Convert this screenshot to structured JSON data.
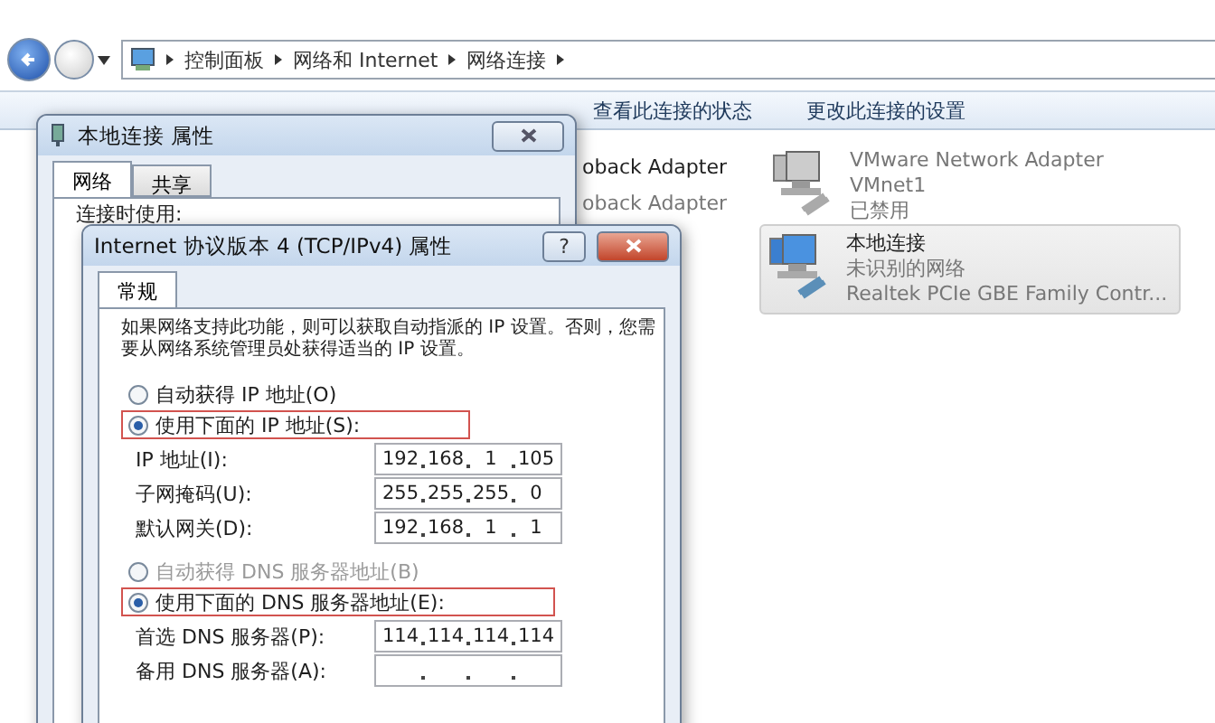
{
  "explorer": {
    "breadcrumb": [
      "控制面板",
      "网络和 Internet",
      "网络连接"
    ],
    "toolbar": [
      "查看此连接的状态",
      "更改此连接的设置"
    ],
    "adapters": [
      {
        "kind": "partial",
        "lines": [
          "oback Adapter"
        ],
        "disabled": false,
        "selected": false
      },
      {
        "kind": "partial",
        "lines": [
          "oback Adapter"
        ],
        "disabled": true,
        "selected": false
      },
      {
        "kind": "full",
        "lines": [
          "VMware Network Adapter",
          "VMnet1",
          "已禁用"
        ],
        "disabled": true,
        "selected": false
      },
      {
        "kind": "full",
        "lines": [
          "本地连接",
          "未识别的网络",
          "Realtek PCIe GBE Family Contr..."
        ],
        "disabled": false,
        "selected": true
      }
    ]
  },
  "properties_dialog": {
    "title": "本地连接 属性",
    "tabs": [
      {
        "label": "网络",
        "selected": true
      },
      {
        "label": "共享",
        "selected": false
      }
    ],
    "connect_using_label": "连接时使用:"
  },
  "ipv4_dialog": {
    "title": "Internet 协议版本 4 (TCP/IPv4) 属性",
    "help": "?",
    "tabs": [
      {
        "label": "常规",
        "selected": true
      }
    ],
    "description": "如果网络支持此功能，则可以获取自动指派的 IP 设置。否则，您需要从网络系统管理员处获得适当的 IP 设置。",
    "ip_mode": [
      {
        "label": "自动获得 IP 地址(O)",
        "selected": false,
        "disabled": false,
        "highlighted": false
      },
      {
        "label": "使用下面的 IP 地址(S):",
        "selected": true,
        "disabled": false,
        "highlighted": true
      }
    ],
    "ip_fields": [
      {
        "label": "IP 地址(I):",
        "octets": [
          "192",
          "168",
          "1",
          "105"
        ]
      },
      {
        "label": "子网掩码(U):",
        "octets": [
          "255",
          "255",
          "255",
          "0"
        ]
      },
      {
        "label": "默认网关(D):",
        "octets": [
          "192",
          "168",
          "1",
          "1"
        ]
      }
    ],
    "dns_mode": [
      {
        "label": "自动获得 DNS 服务器地址(B)",
        "selected": false,
        "disabled": true,
        "highlighted": false
      },
      {
        "label": "使用下面的 DNS 服务器地址(E):",
        "selected": true,
        "disabled": false,
        "highlighted": true
      }
    ],
    "dns_fields": [
      {
        "label": "首选 DNS 服务器(P):",
        "octets": [
          "114",
          "114",
          "114",
          "114"
        ]
      },
      {
        "label": "备用 DNS 服务器(A):"
      }
    ]
  }
}
